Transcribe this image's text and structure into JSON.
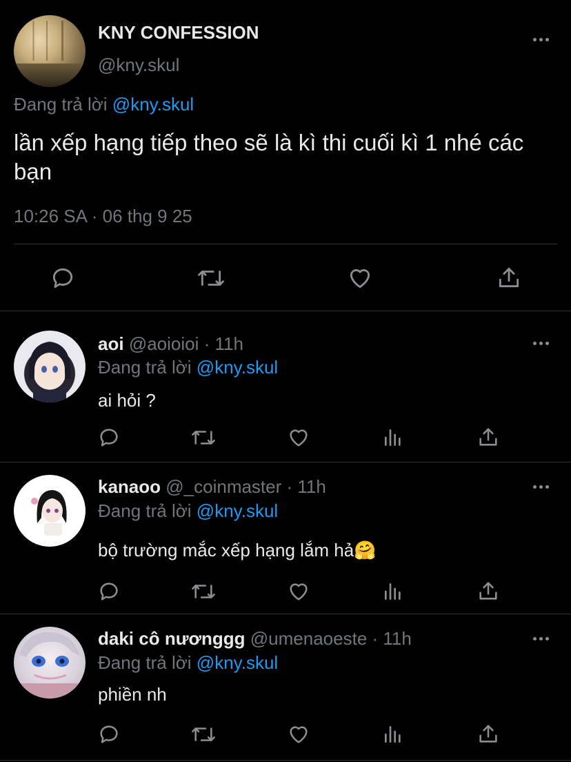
{
  "main": {
    "name": "KNY CONFESSION",
    "handle": "@kny.skul",
    "reply_prefix": "Đang trả lời",
    "reply_to": "@kny.skul",
    "text": "lần xếp hạng tiếp theo sẽ là kì thi cuối kì 1 nhé các bạn",
    "timestamp": "10:26 SA · 06 thg 9 25"
  },
  "replies": [
    {
      "name": "aoi",
      "handle": "@aoioioi",
      "time": "· 11h",
      "reply_prefix": "Đang trả lời",
      "reply_to": "@kny.skul",
      "text": "ai hỏi ?"
    },
    {
      "name": "kanaoo",
      "handle": "@_coinmaster",
      "time": "· 11h",
      "reply_prefix": "Đang trả lời",
      "reply_to": "@kny.skul",
      "text": "bộ trường mắc xếp hạng lắm hả🤗"
    },
    {
      "name": "daki cô nươnggg",
      "handle": "@umenaoeste",
      "time": "· 11h",
      "reply_prefix": "Đang trả lời",
      "reply_to": "@kny.skul",
      "text": "phiền nh"
    }
  ],
  "icons": {
    "reply": "reply-icon",
    "retweet": "retweet-icon",
    "like": "heart-icon",
    "views": "views-icon",
    "share": "share-icon",
    "more": "more-icon"
  },
  "colors": {
    "background": "#000000",
    "text": "#e7e9ea",
    "muted": "#71767b",
    "link": "#1d9bf0",
    "divider": "#2f3336"
  }
}
